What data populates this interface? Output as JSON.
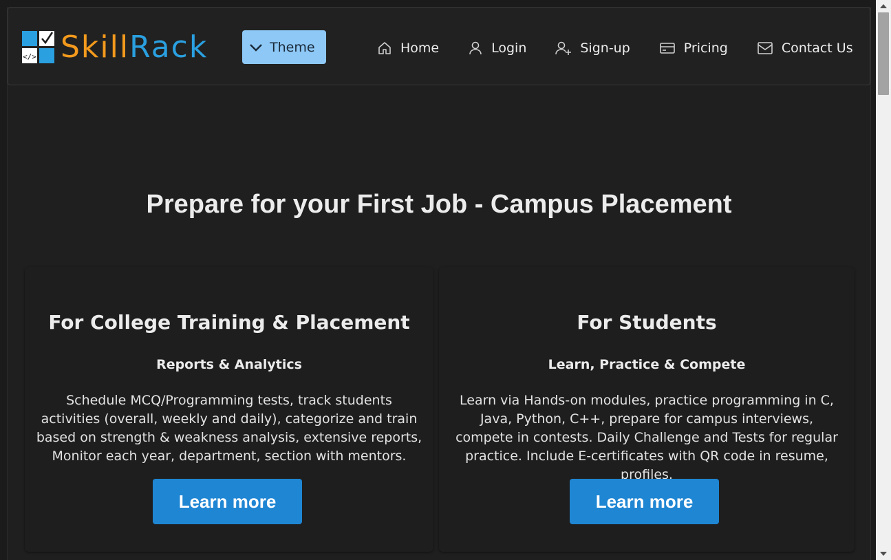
{
  "navbar": {
    "logo": {
      "part1": "Skill",
      "part2": "Rack",
      "icon": "skillrack-logo-icon"
    },
    "theme_label": "Theme",
    "links": [
      {
        "label": "Home",
        "icon": "home-icon"
      },
      {
        "label": "Login",
        "icon": "user-icon"
      },
      {
        "label": "Sign-up",
        "icon": "user-add-icon"
      },
      {
        "label": "Pricing",
        "icon": "credit-card-icon"
      },
      {
        "label": "Contact Us",
        "icon": "envelope-icon"
      }
    ]
  },
  "hero": {
    "title": "Prepare for your First Job - Campus Placement"
  },
  "cards": [
    {
      "title": "For College Training & Placement",
      "subtitle": "Reports & Analytics",
      "description": "Schedule MCQ/Programming tests, track students activities (overall, weekly and daily), categorize and train based on strength & weakness analysis, extensive reports, Monitor each year, department, section with mentors.",
      "button_label": "Learn more"
    },
    {
      "title": "For Students",
      "subtitle": "Learn, Practice & Compete",
      "description": "Learn via Hands-on modules, practice programming in C, Java, Python, C++, prepare for campus interviews, compete in contests. Daily Challenge and Tests for regular practice. Include E-certificates with QR code in resume, profiles.",
      "button_label": "Learn more"
    }
  ],
  "colors": {
    "background": "#1f1f1f",
    "accent_button": "#1f86d3",
    "theme_button": "#8ec8f6",
    "logo_orange": "#f39a1d",
    "logo_blue": "#2aa0e0"
  }
}
